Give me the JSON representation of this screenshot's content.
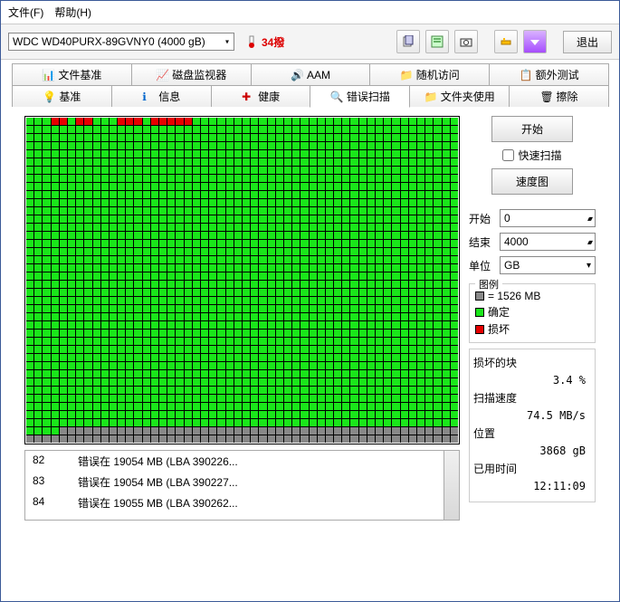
{
  "menu": {
    "file": "文件(F)",
    "help": "帮助(H)"
  },
  "toolbar": {
    "drive": "WDC WD40PURX-89GVNY0 (4000 gB)",
    "temp": "34撥",
    "exit": "退出"
  },
  "tabs_top": {
    "file_bench": "文件基准",
    "disk_monitor": "磁盘监视器",
    "aam": "AAM",
    "random_access": "随机访问",
    "extra_test": "额外测试"
  },
  "tabs_bottom": {
    "bench": "基准",
    "info": "信息",
    "health": "健康",
    "error_scan": "错误扫描",
    "folder_usage": "文件夹使用",
    "erase": "擦除"
  },
  "controls": {
    "start": "开始",
    "quick_scan": "快速扫描",
    "speed_map": "速度图",
    "start_label": "开始",
    "start_val": "0",
    "end_label": "结束",
    "end_val": "4000",
    "unit_label": "单位",
    "unit_val": "GB"
  },
  "legend": {
    "title": "图例",
    "block_size": "= 1526 MB",
    "ok": "确定",
    "damaged": "损坏"
  },
  "stats": {
    "damaged_blocks_label": "损坏的块",
    "damaged_blocks": "3.4 %",
    "scan_speed_label": "扫描速度",
    "scan_speed": "74.5 MB/s",
    "position_label": "位置",
    "position": "3868 gB",
    "elapsed_label": "已用时间",
    "elapsed": "12:11:09"
  },
  "errors": [
    {
      "n": "82",
      "text": "错误在 19054 MB (LBA 390226..."
    },
    {
      "n": "83",
      "text": "错误在 19054 MB (LBA 390227..."
    },
    {
      "n": "84",
      "text": "错误在 19055 MB (LBA 390262..."
    }
  ],
  "grid": {
    "rows": 40,
    "cols": 52,
    "bad_cells": [
      3,
      4,
      6,
      7,
      11,
      12,
      13,
      15,
      16,
      17,
      18,
      19
    ],
    "gray_start_row": 38,
    "gray_start_col": 4
  }
}
